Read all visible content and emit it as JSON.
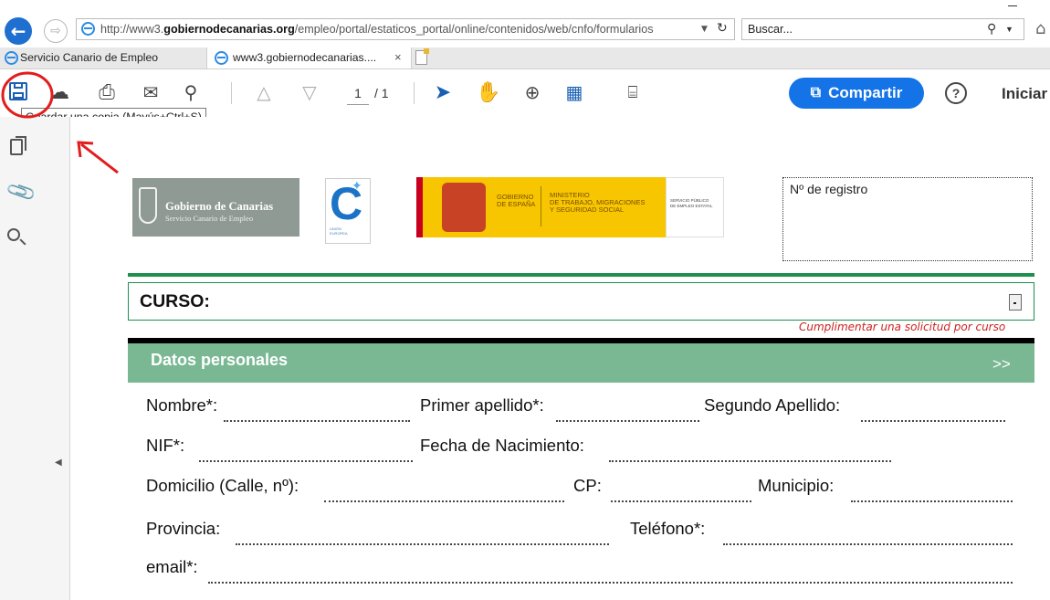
{
  "browser": {
    "url_prefix": "http://www3.",
    "url_domain": "gobiernodecanarias.org",
    "url_path": "/empleo/portal/estaticos_portal/online/contenidos/web/cnfo/formularios",
    "search_placeholder": "Buscar...",
    "tabs": [
      {
        "label": "Servicio Canario de Empleo"
      },
      {
        "label": "www3.gobiernodecanarias...."
      }
    ]
  },
  "pdf_toolbar": {
    "page_current": "1",
    "page_total": "/ 1",
    "share_label": "Compartir",
    "help_label": "?",
    "signin_label": "Iniciar",
    "tooltip": "Guardar una copia (Mayús+Ctrl+S)"
  },
  "logos": {
    "gc_title": "Gobierno de Canarias",
    "gc_sub": "Servicio Canario de Empleo",
    "ministry_gov": "GOBIERNO\nDE ESPAÑA",
    "ministry_name": "MINISTERIO\nDE TRABAJO, MIGRACIONES\nY SEGURIDAD SOCIAL",
    "sepe": "SERVICIO PÚBLICO\nDE EMPLEO ESTATAL",
    "eu_text": "UNIÓN\nEUROPEA"
  },
  "form": {
    "registro_label": "Nº de registro",
    "curso_label": "CURSO:",
    "curso_note": "Cumplimentar una solicitud por curso",
    "section_title": "Datos personales",
    "section_arrow": ">>",
    "fields": {
      "nombre": "Nombre*:",
      "primer_apellido": "Primer apellido*:",
      "segundo_apellido": "Segundo Apellido:",
      "nif": "NIF*:",
      "fecha_nacimiento": "Fecha de Nacimiento:",
      "domicilio": "Domicilio (Calle, nº):",
      "cp": "CP:",
      "municipio": "Municipio:",
      "provincia": "Provincia:",
      "telefono": "Teléfono*:",
      "email": "email*:"
    }
  },
  "colors": {
    "ie_blue": "#1f6fd0",
    "share_blue": "#1473e6",
    "section_green": "#7ab893",
    "rule_green": "#1f8f4e",
    "note_red": "#cc2222",
    "annotation_red": "#e31c1c"
  },
  "icons": [
    "back-arrow-icon",
    "forward-arrow-icon",
    "ie-logo-icon",
    "refresh-icon",
    "search-icon",
    "home-icon",
    "new-tab-icon",
    "save-icon",
    "upload-icon",
    "print-icon",
    "email-icon",
    "comment-icon",
    "page-up-icon",
    "page-down-icon",
    "select-cursor-icon",
    "hand-icon",
    "zoom-in-icon",
    "fit-page-icon",
    "scroll-icon",
    "share-icon",
    "help-icon",
    "pages-icon",
    "attachment-icon",
    "sidebar-search-icon",
    "collapse-arrow-icon"
  ]
}
